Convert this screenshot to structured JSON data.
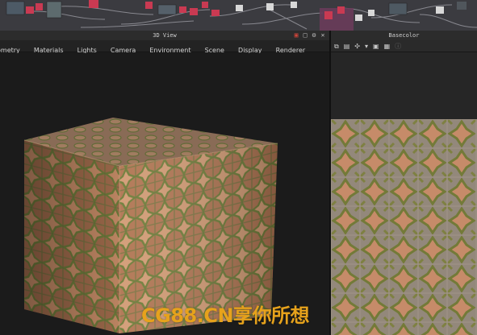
{
  "node_graph": {
    "label": "node graph",
    "accent": "#c93a52"
  },
  "view3d": {
    "title": "3D View",
    "title_icons": [
      "scene-icon",
      "maximize-icon",
      "gear-icon",
      "close-icon"
    ],
    "menu": [
      "ometry",
      "Materials",
      "Lights",
      "Camera",
      "Environment",
      "Scene",
      "Display",
      "Renderer"
    ]
  },
  "basecolor": {
    "title": "Basecolor",
    "toolbar": [
      "copy-icon",
      "save-icon",
      "channel-icon",
      "dropdown-icon",
      "image-icon",
      "grid-icon",
      "info-icon"
    ]
  },
  "watermark": {
    "text": "CG88.CN享你所想",
    "color": "#e6a21c"
  },
  "colors": {
    "panel_bg": "#1b1b1b",
    "terracotta": "#b5754f",
    "moss": "#6d7a33",
    "mortar": "#8a8478"
  }
}
